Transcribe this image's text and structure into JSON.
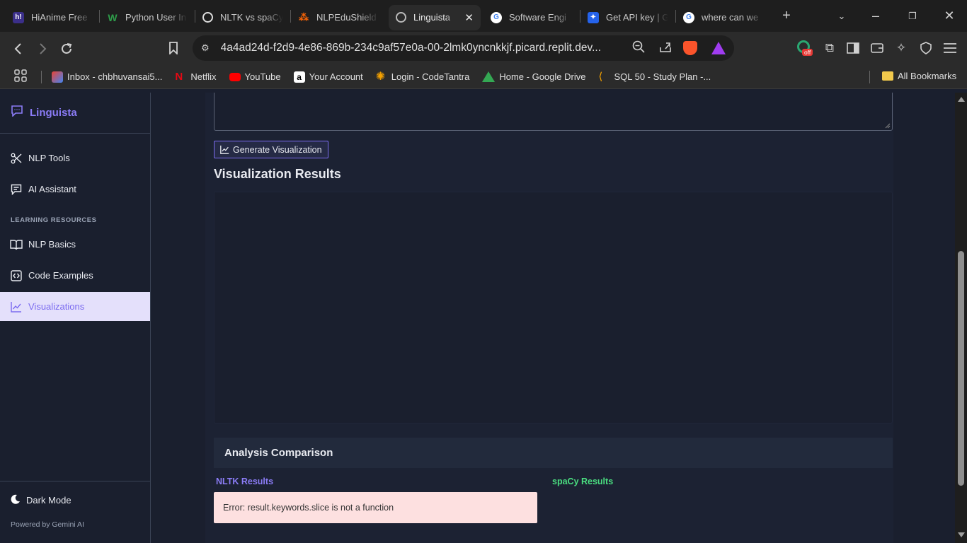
{
  "browser": {
    "tabs": [
      {
        "title": "HiAnime Free",
        "fav": "h!",
        "color": "#6b5bd6"
      },
      {
        "title": "Python User In",
        "fav": "W",
        "color": "#2e7d32"
      },
      {
        "title": "NLTK vs spaCy",
        "fav": "◎",
        "color": "#555555"
      },
      {
        "title": "NLPEduShield",
        "fav": "✣",
        "color": "#e8552d"
      },
      {
        "title": "Linguista",
        "fav": "◍",
        "color": "#777777"
      },
      {
        "title": "Software Engi",
        "fav": "G",
        "color": "#ffffff"
      },
      {
        "title": "Get API key | G",
        "fav": "✦",
        "color": "#3b82f6"
      },
      {
        "title": "where can we",
        "fav": "G",
        "color": "#ffffff"
      }
    ],
    "url": "4a4ad24d-f2d9-4e86-869b-234c9af57e0a-00-2lmk0yncnkkjf.picard.replit.dev...",
    "extension_badge": "off",
    "bookmarks": [
      {
        "label": "Inbox - chbhuvansai5...",
        "color": "#ea4335"
      },
      {
        "label": "Netflix",
        "color": "#e50914"
      },
      {
        "label": "YouTube",
        "color": "#ff0000"
      },
      {
        "label": "Your Account",
        "color": "#ffffff"
      },
      {
        "label": "Login - CodeTantra",
        "color": "#f4a100"
      },
      {
        "label": "Home - Google Drive",
        "color": "#34a853"
      },
      {
        "label": "SQL 50 - Study Plan -...",
        "color": "#f7a300"
      }
    ],
    "all_bookmarks": "All Bookmarks"
  },
  "sidebar": {
    "brand": "Linguista",
    "nav": [
      {
        "label": "NLP Tools"
      },
      {
        "label": "AI Assistant"
      }
    ],
    "section_label": "LEARNING RESOURCES",
    "resources": [
      {
        "label": "NLP Basics"
      },
      {
        "label": "Code Examples"
      },
      {
        "label": "Visualizations"
      }
    ],
    "dark_mode": "Dark Mode",
    "powered_by": "Powered by Gemini AI"
  },
  "main": {
    "generate_button": "Generate Visualization",
    "results_title": "Visualization Results",
    "comparison_title": "Analysis Comparison",
    "nltk_label": "NLTK Results",
    "spacy_label": "spaCy Results",
    "error_message": "Error: result.keywords.slice is not a function"
  },
  "colors": {
    "accent": "#7c6cf0",
    "nltk": "#8b7cf6",
    "spacy": "#4ade80",
    "error_bg": "#fde0e0"
  }
}
